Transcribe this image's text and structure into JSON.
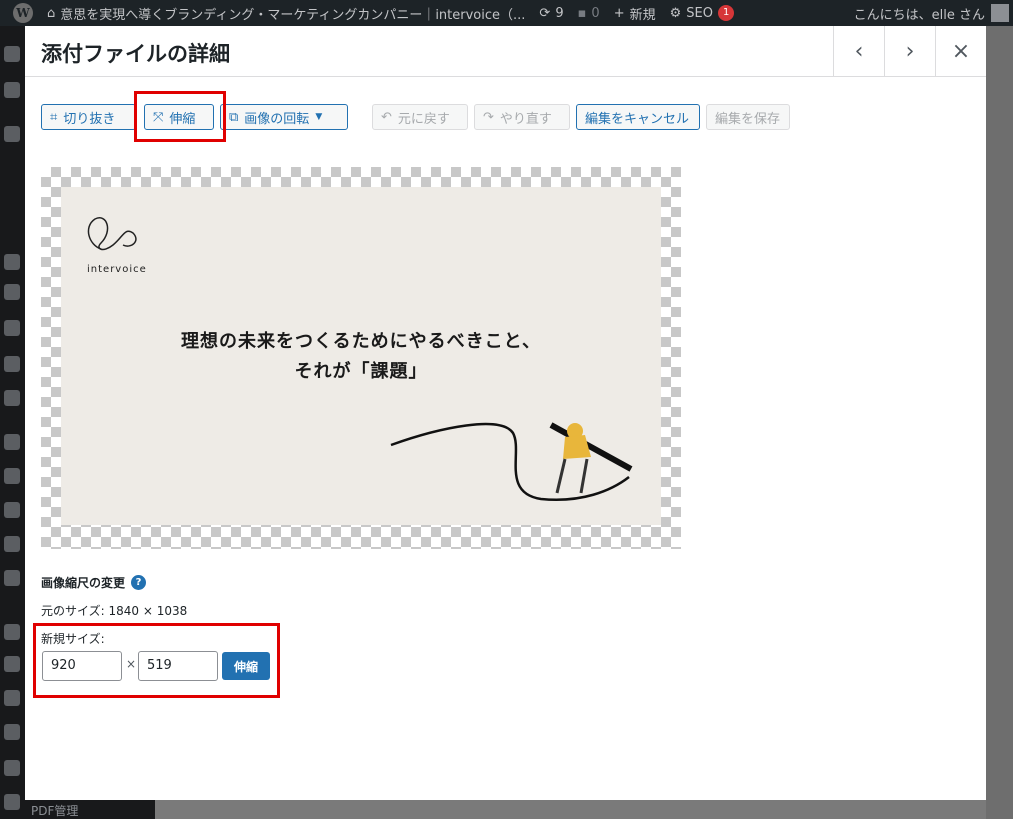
{
  "admin_bar": {
    "site_name": "意思を実現へ導くブランディング・マーケティングカンパニー｜intervoice（...",
    "updates_count": "9",
    "comments_count": "0",
    "new_label": "新規",
    "seo_label": "SEO",
    "seo_badge": "1",
    "greeting": "こんにちは、elle さん"
  },
  "background": {
    "menu_bottom_label": "PDF管理"
  },
  "modal": {
    "title": "添付ファイルの詳細",
    "prev_label": "‹",
    "next_label": "›",
    "close_label": "×"
  },
  "toolbar": {
    "crop": "切り抜き",
    "scale": "伸縮",
    "rotate": "画像の回転",
    "undo": "元に戻す",
    "redo": "やり直す",
    "cancel_edit": "編集をキャンセル",
    "save_edit": "編集を保存"
  },
  "image": {
    "logo_text": "intervoice",
    "headline_line1": "理想の未来をつくるためにやるべきこと、",
    "headline_line2": "それが「課題」"
  },
  "scale_panel": {
    "title": "画像縮尺の変更",
    "help": "?",
    "original_size": "元のサイズ: 1840 × 1038",
    "new_size_label": "新規サイズ:",
    "width": "920",
    "separator": "×",
    "height": "519",
    "apply": "伸縮"
  },
  "colors": {
    "accent": "#2271b1",
    "highlight": "#e00000",
    "illustration_yellow": "#e8b63b"
  }
}
